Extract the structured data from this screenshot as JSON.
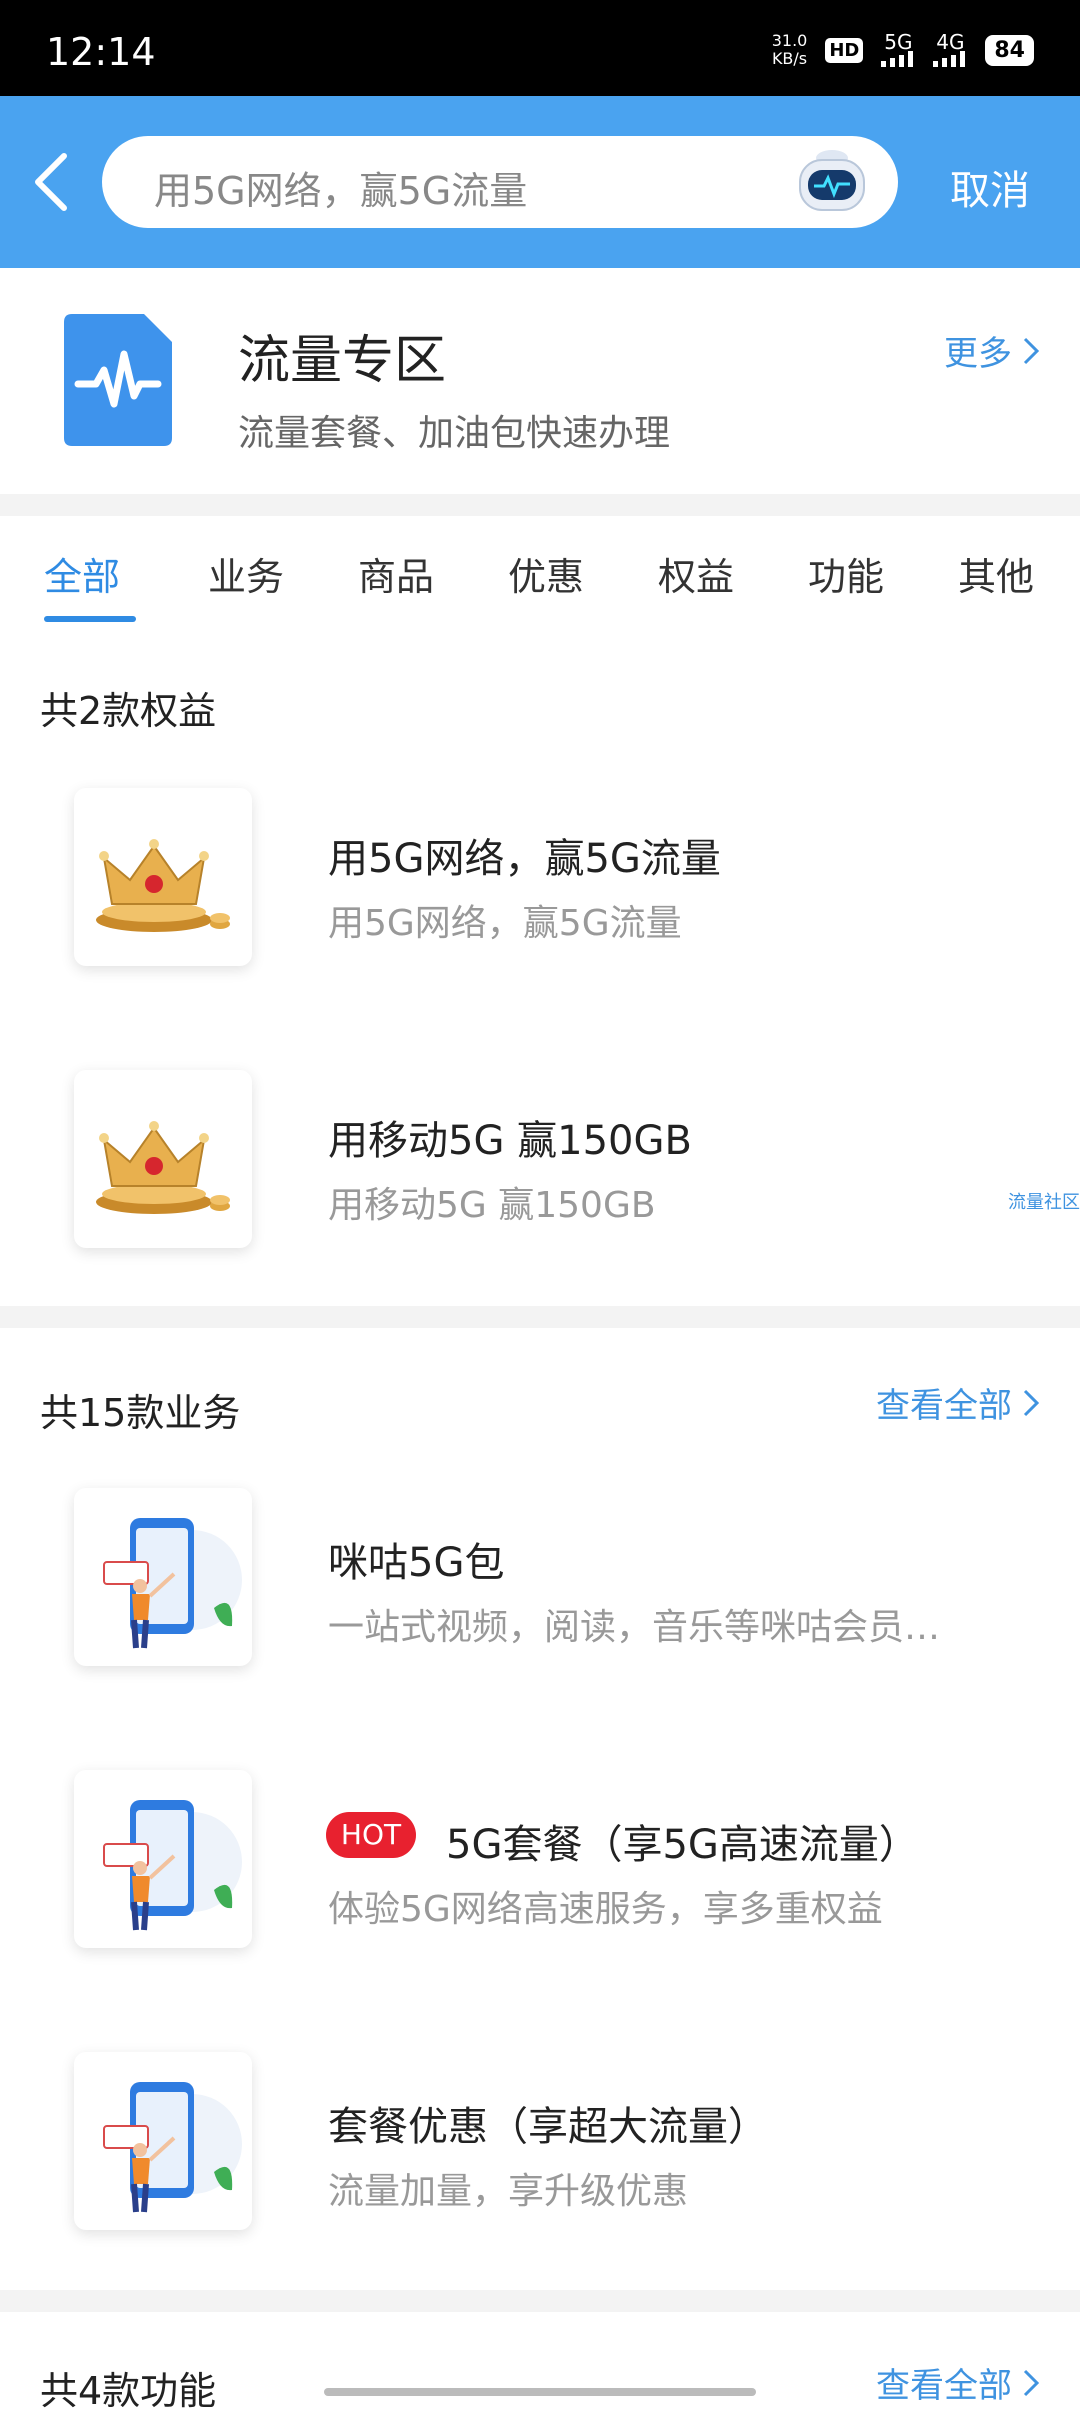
{
  "status_bar": {
    "time": "12:14",
    "net_speed_value": "31.0",
    "net_speed_unit": "KB/s",
    "hd": "HD",
    "signal1": "5G",
    "signal2": "4G",
    "battery": "84"
  },
  "header": {
    "search_text": "用5G网络，赢5G流量",
    "cancel_label": "取消",
    "accent_color": "#4aa3f0"
  },
  "zone": {
    "title": "流量专区",
    "subtitle": "流量套餐、加油包快速办理",
    "more_label": "更多"
  },
  "tabs": [
    "全部",
    "业务",
    "商品",
    "优惠",
    "权益",
    "功能",
    "其他"
  ],
  "rights": {
    "title": "共2款权益",
    "items": [
      {
        "title": "用5G网络，赢5G流量",
        "subtitle": "用5G网络，赢5G流量",
        "icon": "crown-icon"
      },
      {
        "title": "用移动5G  赢150GB",
        "subtitle": "用移动5G  赢150GB",
        "icon": "crown-icon"
      }
    ],
    "side_tag": "流量社区"
  },
  "business": {
    "title": "共15款业务",
    "see_all": "查看全部",
    "items": [
      {
        "title": "咪咕5G包",
        "subtitle": "一站式视频，阅读，音乐等咪咕会员…",
        "icon": "phone-person-icon"
      },
      {
        "badge": "HOT",
        "title": "5G套餐（享5G高速流量）",
        "subtitle": "体验5G网络高速服务，享多重权益",
        "icon": "phone-person-icon"
      },
      {
        "title": "套餐优惠（享超大流量）",
        "subtitle": "流量加量，享升级优惠",
        "icon": "phone-person-icon"
      }
    ]
  },
  "features": {
    "title": "共4款功能",
    "see_all": "查看全部"
  }
}
